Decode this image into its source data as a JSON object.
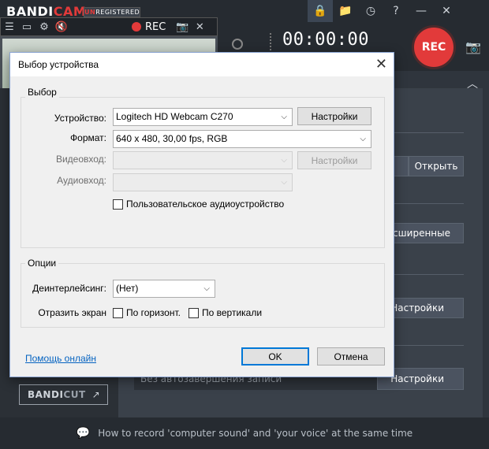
{
  "app": {
    "logo_main": "BANDI",
    "logo_accent": "CAM",
    "badge_accent": "UN",
    "badge_rest": "REGISTERED",
    "rec_label": "REC",
    "timer": "00:00:00",
    "rec_button": "REC",
    "open_button": "Открыть",
    "advanced_button": "асширенные",
    "settings_button_1": "Настройки",
    "settings_button_2": "Настройки",
    "strip_text": "Без автозавершения записи",
    "bandicut_main": "BANDI",
    "bandicut_accent": "CUT",
    "footer_text": "How to record 'computer sound' and 'your voice' at the same time"
  },
  "dialog": {
    "title": "Выбор устройства",
    "close": "✕",
    "group_select": "Выбор",
    "device_label": "Устройство:",
    "device_value": "Logitech HD Webcam C270",
    "device_settings": "Настройки",
    "format_label": "Формат:",
    "format_value": "640 x 480, 30,00 fps, RGB",
    "video_in_label": "Видеовход:",
    "video_in_settings": "Настройки",
    "audio_in_label": "Аудиовход:",
    "custom_audio": "Пользовательское аудиоустройство",
    "group_options": "Опции",
    "deinterlace_label": "Деинтерлейсинг:",
    "deinterlace_value": "(Нет)",
    "mirror_label": "Отразить экран",
    "mirror_h": "По горизонт.",
    "mirror_v": "По вертикали",
    "help_link": "Помощь онлайн",
    "ok": "OK",
    "cancel": "Отмена"
  }
}
